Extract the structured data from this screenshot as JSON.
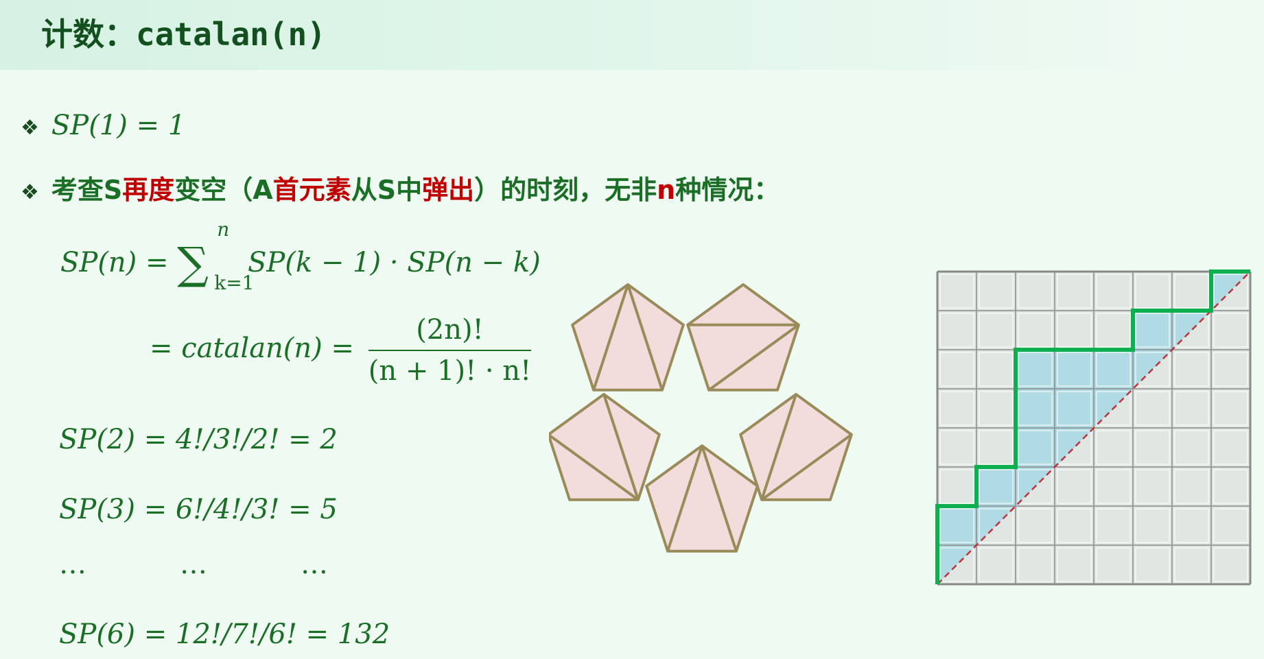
{
  "title": {
    "prefix": "计数：",
    "code": "catalan(n)"
  },
  "line1": {
    "diamond": "❖",
    "math": "SP(1) = 1"
  },
  "line2": {
    "diamond": "❖",
    "segments": [
      {
        "text": "考查S",
        "color": "#1b6e26"
      },
      {
        "text": "再度",
        "color": "#c00000"
      },
      {
        "text": "变空（A",
        "color": "#1b6e26"
      },
      {
        "text": "首元素",
        "color": "#c00000"
      },
      {
        "text": "从S中",
        "color": "#1b6e26"
      },
      {
        "text": "弹出",
        "color": "#c00000"
      },
      {
        "text": "）的时刻，无非",
        "color": "#1b6e26"
      },
      {
        "text": "n",
        "color": "#c00000"
      },
      {
        "text": "种情况：",
        "color": "#1b6e26"
      }
    ]
  },
  "formula": {
    "lhs": "SP(n) = ",
    "sum_symbol": "∑",
    "sum_upper": "n",
    "sum_lower": "k=1",
    "rhs": " SP(k − 1) · SP(n − k)",
    "line2_prefix": "= catalan(n) = ",
    "frac_num": "(2n)!",
    "frac_den": "(n + 1)! · n!"
  },
  "examples": [
    "SP(2) = 4!/3!/2! = 2",
    "SP(3) = 6!/4!/3! = 5",
    "SP(6) = 12!/7!/6! = 132"
  ],
  "ellipsis": [
    "…",
    "…",
    "…"
  ],
  "colors": {
    "pentagon_fill": "#f2dcdc",
    "pentagon_stroke": "#9a8c5a",
    "grid_fill": "#e0e7e2",
    "grid_line": "#8a8a8a",
    "path": "#0db04f",
    "shade": "#a8d8e4",
    "diagonal": "#c0323c"
  },
  "lattice": {
    "size": 8,
    "path_heights": [
      2,
      3,
      6,
      6,
      6,
      7,
      7,
      8
    ]
  }
}
